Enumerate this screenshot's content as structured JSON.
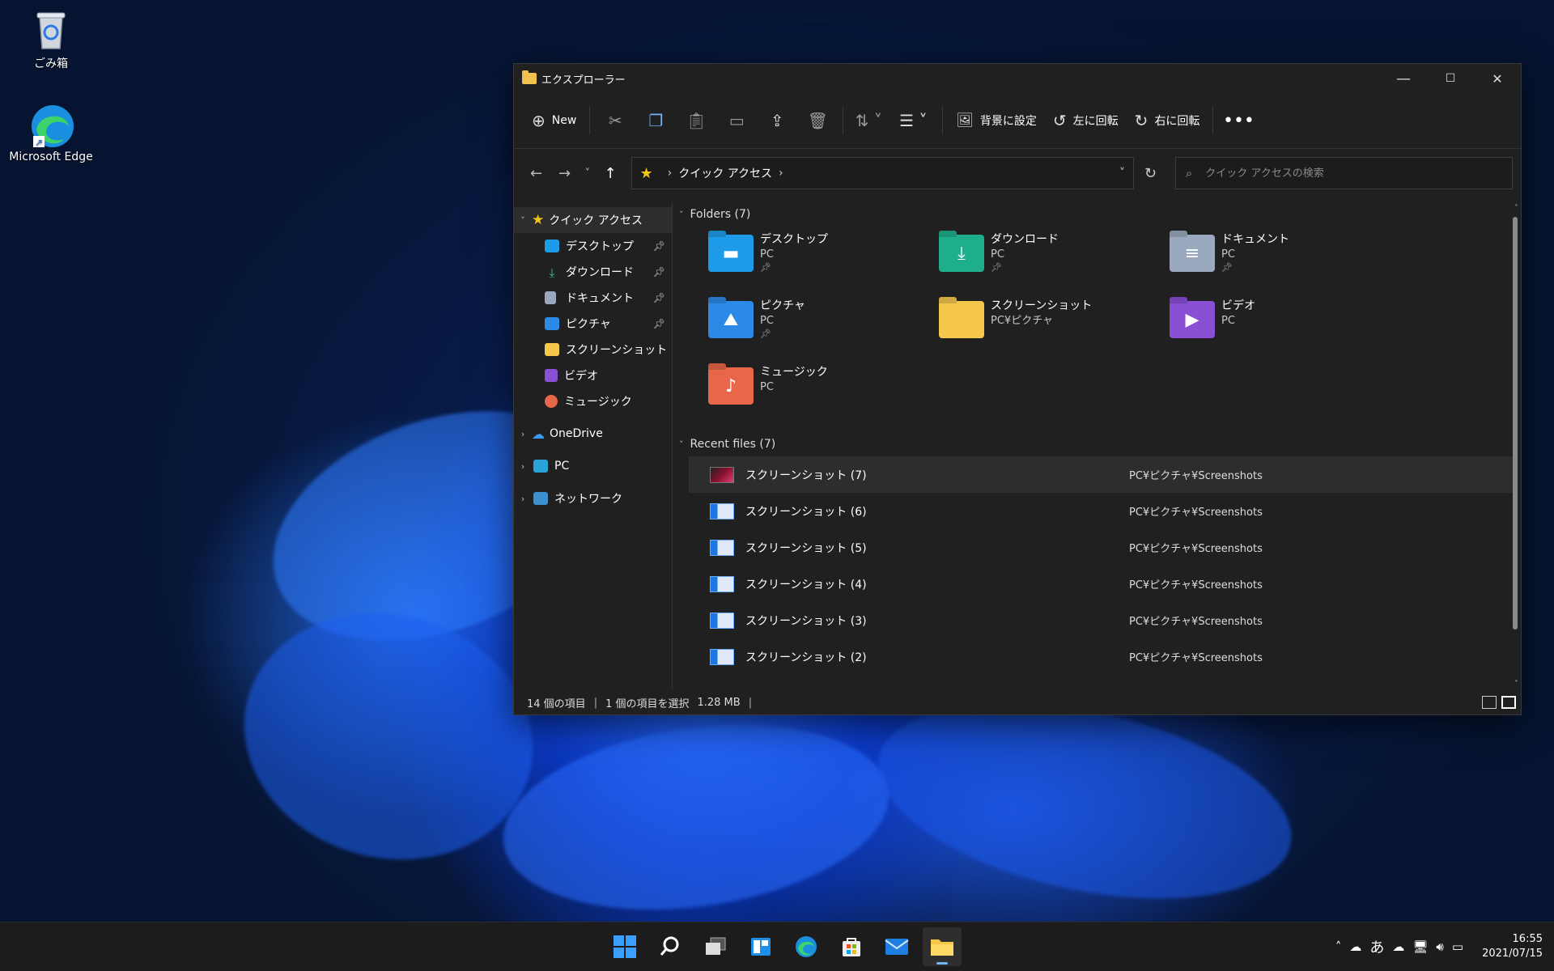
{
  "desktop": {
    "icons": [
      {
        "label": "ごみ箱"
      },
      {
        "label": "Microsoft Edge"
      }
    ]
  },
  "window": {
    "title": "エクスプローラー",
    "controls": {
      "minimize": "—",
      "maximize": "☐",
      "close": "✕"
    }
  },
  "toolbar": {
    "new_label": "New",
    "set_background_label": "背景に設定",
    "rotate_left_label": "左に回転",
    "rotate_right_label": "右に回転"
  },
  "address": {
    "path": "クイック アクセス",
    "search_placeholder": "クイック アクセスの検索"
  },
  "sidebar": {
    "quick_access": "クイック アクセス",
    "items": [
      {
        "label": "デスクトップ",
        "pinned": true
      },
      {
        "label": "ダウンロード",
        "pinned": true
      },
      {
        "label": "ドキュメント",
        "pinned": true
      },
      {
        "label": "ピクチャ",
        "pinned": true
      },
      {
        "label": "スクリーンショット",
        "pinned": false
      },
      {
        "label": "ビデオ",
        "pinned": false
      },
      {
        "label": "ミュージック",
        "pinned": false
      }
    ],
    "onedrive": "OneDrive",
    "pc": "PC",
    "network": "ネットワーク"
  },
  "folders": {
    "header": "Folders (7)",
    "items": [
      {
        "name": "デスクトップ",
        "path": "PC",
        "pinned": true,
        "color": "#1e9be8"
      },
      {
        "name": "ダウンロード",
        "path": "PC",
        "pinned": true,
        "color": "#1fae8c"
      },
      {
        "name": "ドキュメント",
        "path": "PC",
        "pinned": true,
        "color": "#9aa9bf"
      },
      {
        "name": "ピクチャ",
        "path": "PC",
        "pinned": true,
        "color": "#2a8ae6"
      },
      {
        "name": "スクリーンショット",
        "path": "PC¥ピクチャ",
        "pinned": false,
        "color": "#f5c84c"
      },
      {
        "name": "ビデオ",
        "path": "PC",
        "pinned": false,
        "color": "#8b4fd6"
      },
      {
        "name": "ミュージック",
        "path": "PC",
        "pinned": false,
        "color": "#e8664a"
      }
    ]
  },
  "recent": {
    "header": "Recent files (7)",
    "items": [
      {
        "name": "スクリーンショット (7)",
        "location": "PC¥ピクチャ¥Screenshots"
      },
      {
        "name": "スクリーンショット (6)",
        "location": "PC¥ピクチャ¥Screenshots"
      },
      {
        "name": "スクリーンショット (5)",
        "location": "PC¥ピクチャ¥Screenshots"
      },
      {
        "name": "スクリーンショット (4)",
        "location": "PC¥ピクチャ¥Screenshots"
      },
      {
        "name": "スクリーンショット (3)",
        "location": "PC¥ピクチャ¥Screenshots"
      },
      {
        "name": "スクリーンショット (2)",
        "location": "PC¥ピクチャ¥Screenshots"
      }
    ]
  },
  "status": {
    "item_count": "14 個の項目",
    "selection": "1 個の項目を選択",
    "size": "1.28 MB"
  },
  "taskbar": {
    "ime": "あ",
    "time": "16:55",
    "date": "2021/07/15"
  }
}
